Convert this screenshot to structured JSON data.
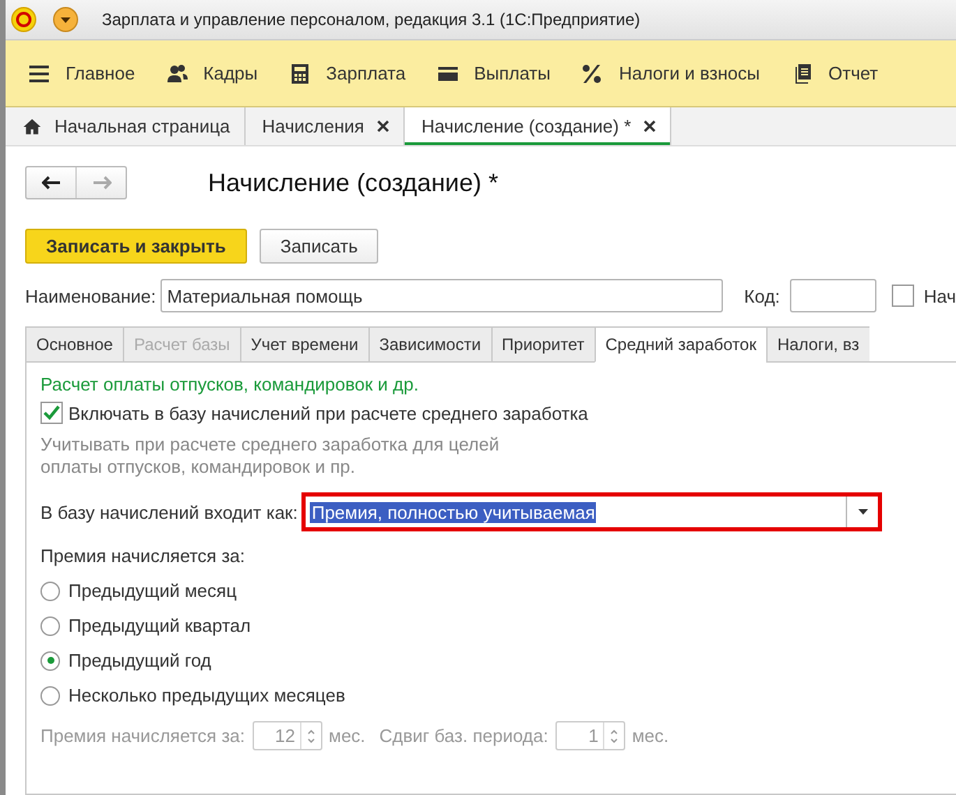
{
  "window": {
    "title": "Зарплата и управление персоналом, редакция 3.1  (1С:Предприятие)"
  },
  "menu": [
    {
      "label": "Главное"
    },
    {
      "label": "Кадры"
    },
    {
      "label": "Зарплата"
    },
    {
      "label": "Выплаты"
    },
    {
      "label": "Налоги и взносы"
    },
    {
      "label": "Отчет"
    }
  ],
  "open_tabs": [
    {
      "label": "Начальная страница",
      "kind": "home",
      "selected": false
    },
    {
      "label": "Начисления",
      "kind": "closable",
      "selected": false
    },
    {
      "label": "Начисление (создание) *",
      "kind": "closable",
      "selected": true
    }
  ],
  "form": {
    "title": "Начисление (создание) *",
    "buttons": [
      {
        "label": "Записать и закрыть",
        "kind": "primary"
      },
      {
        "label": "Записать",
        "kind": "normal"
      }
    ],
    "name_label": "Наименование:",
    "name_value": "Материальная помощь",
    "code_label": "Код:",
    "extra_checkbox": {
      "label": "Нач",
      "checked": false
    },
    "tabs": [
      {
        "label": "Основное",
        "selected": false,
        "disabled": false
      },
      {
        "label": "Расчет базы",
        "selected": false,
        "disabled": true
      },
      {
        "label": "Учет времени",
        "selected": false,
        "disabled": false
      },
      {
        "label": "Зависимости",
        "selected": false,
        "disabled": false
      },
      {
        "label": "Приоритет",
        "selected": false,
        "disabled": false
      },
      {
        "label": "Средний заработок",
        "selected": true,
        "disabled": false
      },
      {
        "label": "Налоги, вз",
        "selected": false,
        "disabled": false
      }
    ],
    "section_title": "Расчет оплаты отпусков, командировок и др.",
    "include_checkbox": {
      "label": "Включать в базу начислений при расчете среднего заработка",
      "checked": true
    },
    "hint": "Учитывать при расчете среднего заработка для целей оплаты отпусков, командировок и пр.",
    "base_label": "В базу начислений входит как:",
    "base_value": "Премия, полностью учитываемая",
    "period_label": "Премия начисляется за:",
    "periods": [
      {
        "label": "Предыдущий месяц",
        "selected": false
      },
      {
        "label": "Предыдущий квартал",
        "selected": false
      },
      {
        "label": "Предыдущий год",
        "selected": true
      },
      {
        "label": "Несколько предыдущих месяцев",
        "selected": false
      }
    ],
    "months_row": {
      "disabled": true,
      "label": "Премия начисляется за:",
      "months": "12",
      "unit": "мес.",
      "shift_label": "Сдвиг баз. периода:",
      "shift": "1",
      "shift_unit": "мес."
    }
  }
}
